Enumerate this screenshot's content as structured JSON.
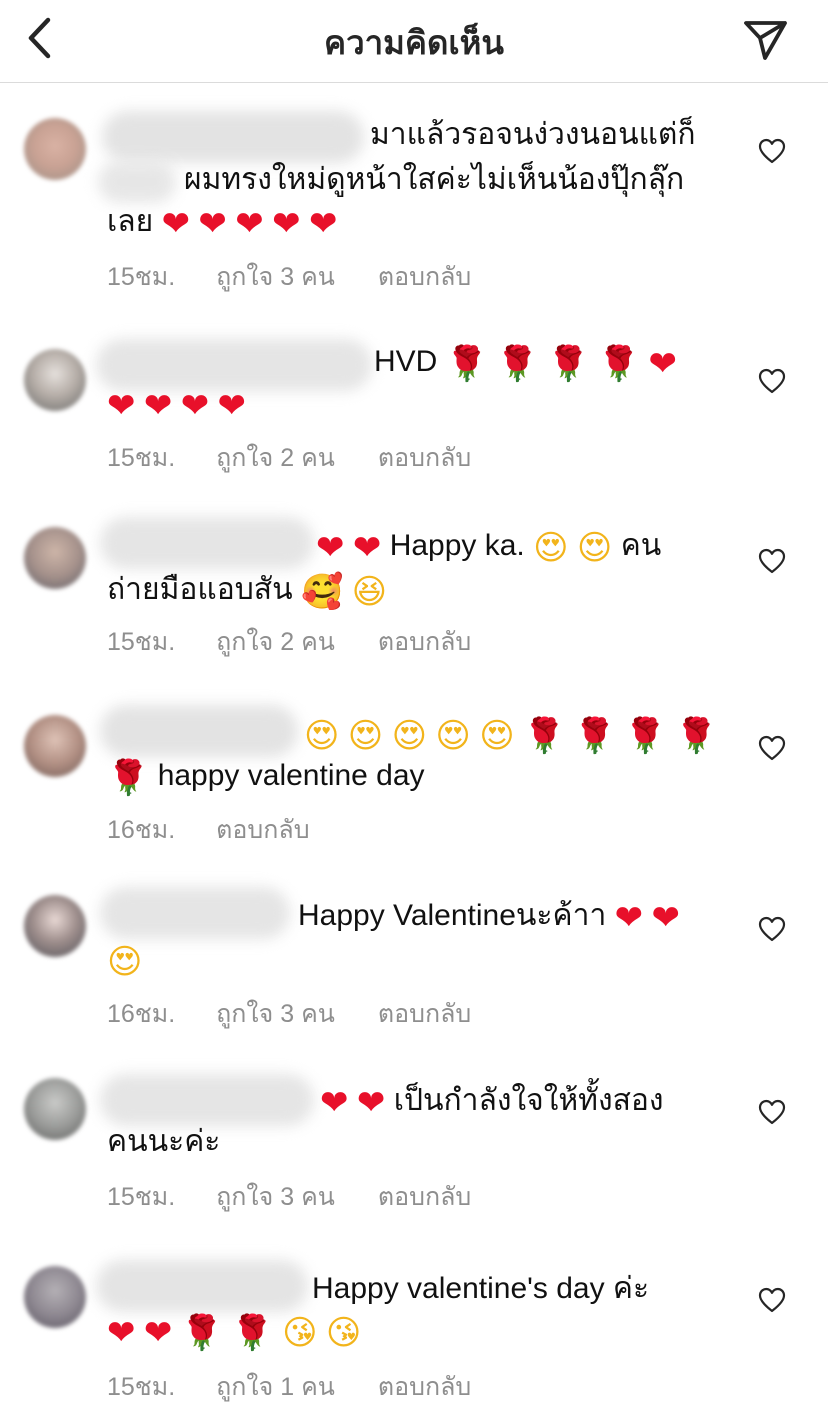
{
  "header": {
    "title": "ความคิดเห็น",
    "back_icon": "chevron-left-icon",
    "share_icon": "paper-plane-icon"
  },
  "colors": {
    "heart": "#e8102a",
    "rose": "#c8101e",
    "face": "#f2b41b",
    "meta_text": "#8e8e8e",
    "text": "#111111"
  },
  "comments": [
    {
      "line1": "มาแล้วรอจนง่วงนอนแต่ก็",
      "line2": "ผมทรงใหม่ดูหน้าใสค่ะไม่เห็นน้องปุ๊กลุ๊ก",
      "line3": "เลย",
      "emojis": [
        "❤",
        "❤",
        "❤",
        "❤",
        "❤"
      ],
      "time": "15ชม.",
      "likes": "ถูกใจ 3 คน",
      "reply": "ตอบกลับ"
    },
    {
      "line1": "HVD",
      "emojis_a": [
        "🌹",
        "🌹",
        "🌹",
        "🌹",
        "❤"
      ],
      "emojis_b": [
        "❤",
        "❤",
        "❤",
        "❤"
      ],
      "time": "15ชม.",
      "likes": "ถูกใจ 2 คน",
      "reply": "ตอบกลับ"
    },
    {
      "line1": "Happy ka.",
      "line1_suffix": "คน",
      "line2": "ถ่ายมือแอบสัน",
      "time": "15ชม.",
      "likes": "ถูกใจ 2 คน",
      "reply": "ตอบกลับ"
    },
    {
      "line2": "happy valentine day",
      "time": "16ชม.",
      "reply": "ตอบกลับ"
    },
    {
      "line1": "Happy Valentineนะค้าา",
      "time": "16ชม.",
      "likes": "ถูกใจ 3 คน",
      "reply": "ตอบกลับ"
    },
    {
      "line1": "เป็นกำลังใจให้ทั้งสอง",
      "line2": "คนนะค่ะ",
      "time": "15ชม.",
      "likes": "ถูกใจ 3 คน",
      "reply": "ตอบกลับ"
    },
    {
      "line1": "Happy valentine's day ค่ะ",
      "time": "15ชม.",
      "likes": "ถูกใจ 1 คน",
      "reply": "ตอบกลับ"
    }
  ]
}
